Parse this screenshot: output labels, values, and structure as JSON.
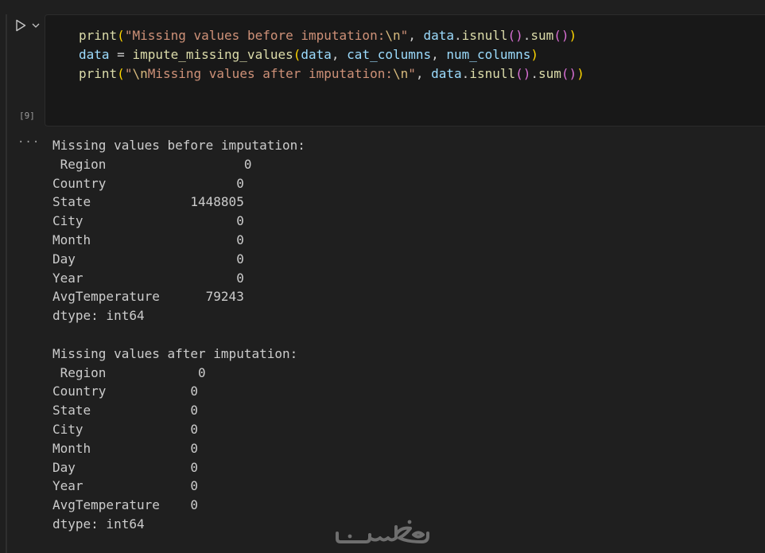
{
  "cell": {
    "execution_count": "[9]",
    "run_icon": "play-icon",
    "run_menu_icon": "chevron-down-icon",
    "code_lines": [
      [
        {
          "t": "print",
          "c": "fn"
        },
        {
          "t": "(",
          "c": "br2"
        },
        {
          "t": "\"Missing values before imputation:",
          "c": "str"
        },
        {
          "t": "\\n",
          "c": "esc"
        },
        {
          "t": "\"",
          "c": "str"
        },
        {
          "t": ", ",
          "c": "plain"
        },
        {
          "t": "data",
          "c": "var"
        },
        {
          "t": ".",
          "c": "plain"
        },
        {
          "t": "isnull",
          "c": "fn"
        },
        {
          "t": "()",
          "c": "br1"
        },
        {
          "t": ".",
          "c": "plain"
        },
        {
          "t": "sum",
          "c": "fn"
        },
        {
          "t": "()",
          "c": "br1"
        },
        {
          "t": ")",
          "c": "br2"
        }
      ],
      [
        {
          "t": "data",
          "c": "var"
        },
        {
          "t": " = ",
          "c": "plain"
        },
        {
          "t": "impute_missing_values",
          "c": "fn"
        },
        {
          "t": "(",
          "c": "br2"
        },
        {
          "t": "data",
          "c": "var"
        },
        {
          "t": ", ",
          "c": "plain"
        },
        {
          "t": "cat_columns",
          "c": "var"
        },
        {
          "t": ", ",
          "c": "plain"
        },
        {
          "t": "num_columns",
          "c": "var"
        },
        {
          "t": ")",
          "c": "br2"
        }
      ],
      [
        {
          "t": "print",
          "c": "fn"
        },
        {
          "t": "(",
          "c": "br2"
        },
        {
          "t": "\"",
          "c": "str"
        },
        {
          "t": "\\n",
          "c": "esc"
        },
        {
          "t": "Missing values after imputation:",
          "c": "str"
        },
        {
          "t": "\\n",
          "c": "esc"
        },
        {
          "t": "\"",
          "c": "str"
        },
        {
          "t": ", ",
          "c": "plain"
        },
        {
          "t": "data",
          "c": "var"
        },
        {
          "t": ".",
          "c": "plain"
        },
        {
          "t": "isnull",
          "c": "fn"
        },
        {
          "t": "()",
          "c": "br1"
        },
        {
          "t": ".",
          "c": "plain"
        },
        {
          "t": "sum",
          "c": "fn"
        },
        {
          "t": "()",
          "c": "br1"
        },
        {
          "t": ")",
          "c": "br2"
        }
      ]
    ]
  },
  "output": {
    "toggle_label": "···",
    "lines": [
      "Missing values before imputation:",
      " Region                  0",
      "Country                 0",
      "State             1448805",
      "City                    0",
      "Month                   0",
      "Day                     0",
      "Year                    0",
      "AvgTemperature      79243",
      "dtype: int64",
      "",
      "Missing values after imputation:",
      " Region            0",
      "Country           0",
      "State             0",
      "City              0",
      "Month             0",
      "Day               0",
      "Year              0",
      "AvgTemperature    0",
      "dtype: int64"
    ]
  },
  "watermark": {
    "text": "خمسات",
    "color": "#6e6e6e"
  },
  "colors": {
    "background": "#1f1f1f",
    "cell_background": "#181818",
    "function": "#dcdcaa",
    "string": "#ce9178",
    "escape": "#d7ba7d",
    "variable": "#9cdcfe",
    "bracket_level_1": "#ffd700",
    "bracket_level_2": "#da70d6"
  }
}
